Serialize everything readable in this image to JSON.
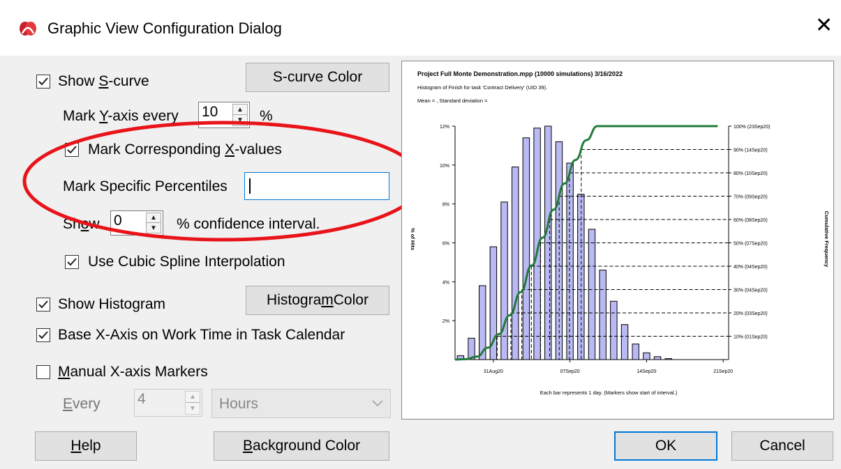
{
  "window": {
    "title": "Graphic View Configuration Dialog",
    "close_glyph": "✕"
  },
  "options": {
    "show_scurve": {
      "label_pre": "Show ",
      "label_u": "S",
      "label_post": "-curve",
      "checked": true
    },
    "scurve_color_button": "S-curve Color",
    "mark_y_axis": {
      "label_pre": "Mark ",
      "label_u": "Y",
      "label_post": "-axis every",
      "value": "10",
      "unit": "%"
    },
    "mark_x_values": {
      "label_pre": "Mark Corresponding ",
      "label_u": "X",
      "label_post": "-values",
      "checked": true
    },
    "mark_percentiles": {
      "label": "Mark Specific Percentiles",
      "value": ""
    },
    "confidence": {
      "label_pre": "Sh",
      "label_u": "o",
      "label_post": "w",
      "value": "0",
      "suffix": "% confidence  interval."
    },
    "cubic_spline": {
      "label": "Use Cubic Spline Interpolation",
      "checked": true
    },
    "show_histogram": {
      "label": "Show Histogram",
      "checked": true
    },
    "histogram_color_button": {
      "pre": "Histogra",
      "u": "m",
      "post": " Color"
    },
    "base_x_axis": {
      "label": "Base X-Axis on Work Time in Task Calendar",
      "checked": true
    },
    "manual_x_markers": {
      "label_u": "M",
      "label_post": "anual X-axis Markers",
      "checked": false
    },
    "every": {
      "label_u": "E",
      "label_post": "very",
      "value": "4",
      "unit": "Hours"
    }
  },
  "buttons": {
    "help": {
      "u": "H",
      "post": "elp"
    },
    "background": {
      "u": "B",
      "post": "ackground Color"
    },
    "ok": "OK",
    "cancel": "Cancel"
  },
  "colors": {
    "bar_fill": "#b9b9f3",
    "curve": "#1f7a3a",
    "highlight": "#e8141a",
    "accent": "#0078d7"
  },
  "chart_data": {
    "type": "bar",
    "title": "Project Full Monte Demonstration.mpp (10000 simulations) 3/16/2022",
    "subtitle": "Histogram of Finish for task 'Contract Delivery' (UID 39).",
    "stats_line": "Mean = , Standard deviation =",
    "ylabel": "% of Hits",
    "y2label": "Cumulative Frequency",
    "xlabel": "Each bar represents 1 day.  (Markers show start of interval.)",
    "y_ticks": [
      "12%",
      "10%",
      "8%",
      "6%",
      "4%",
      "2%"
    ],
    "y_tick_values": [
      12,
      10,
      8,
      6,
      4,
      2
    ],
    "ylim": [
      0,
      12
    ],
    "x_ticks": [
      "31Aug20",
      "07Sep20",
      "14Sep20",
      "21Sep20"
    ],
    "x_tick_positions": [
      3.5,
      10.5,
      17.5,
      24.5
    ],
    "values": [
      0.2,
      1.1,
      3.8,
      5.8,
      8.1,
      9.9,
      11.4,
      11.9,
      12.0,
      11.2,
      10.1,
      8.5,
      6.7,
      4.6,
      3.0,
      1.8,
      0.8,
      0.35,
      0.15,
      0.05
    ],
    "cumulative": [
      0,
      0.2,
      1.3,
      5.1,
      10.9,
      19.0,
      28.9,
      40.3,
      52.2,
      64.2,
      75.4,
      85.5,
      94.0,
      100.0,
      100.0,
      100.0,
      100.0,
      100.0,
      100.0,
      100.0,
      100.0,
      100.0,
      100.0,
      100.0,
      100.0
    ],
    "percentile_labels": [
      "100% (23Sep20)",
      "90% (14Sep20)",
      "80% (10Sep20)",
      "70% (09Sep20)",
      "60% (08Sep20)",
      "50% (07Sep20)",
      "40% (04Sep20)",
      "30% (04Sep20)",
      "20% (03Sep20)",
      "10% (01Sep20)"
    ],
    "percentile_values": [
      100,
      90,
      80,
      70,
      60,
      50,
      40,
      30,
      20,
      10
    ],
    "grid": false,
    "legend": "none"
  }
}
